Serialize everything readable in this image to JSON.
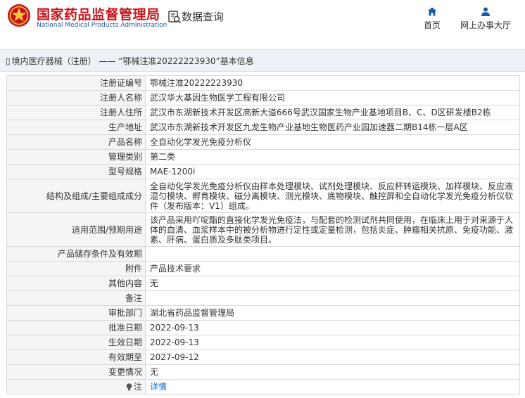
{
  "header": {
    "logo_cn": "国家药品监督管理局",
    "logo_en": "National Medical Products Administration",
    "query_label": "数据查询",
    "nav": [
      {
        "label": "首页",
        "icon": "home-icon"
      },
      {
        "label": "网上办事大厅",
        "icon": "user-icon"
      }
    ],
    "brand_color": "#c8161d",
    "accent_color": "#1a5aa6"
  },
  "breadcrumb": {
    "category": "境内医疗器械（注册）",
    "separator": "——",
    "title": "“鄂械注准20222223930”基本信息"
  },
  "details": {
    "reg_no": {
      "label": "注册证编号",
      "value": "鄂械注准20222223930"
    },
    "registrant": {
      "label": "注册人名称",
      "value": "武汉华大基因生物医学工程有限公司"
    },
    "registrant_address": {
      "label": "注册人住所",
      "value": "武汉市东湖新技术开发区高新大道666号武汉国家生物产业基地项目B、C、D区研发楼B2栋"
    },
    "production_address": {
      "label": "生产地址",
      "value": "武汉市东湖新技术开发区九龙生物产业基地生物医药产业园加速器二期B14栋一层A区"
    },
    "product_name": {
      "label": "产品名称",
      "value": "全自动化学发光免疫分析仪"
    },
    "management_class": {
      "label": "管理类别",
      "value": "第二类"
    },
    "model_spec": {
      "label": "型号规格",
      "value": "MAE-1200i"
    },
    "structure": {
      "label": "结构及组成/主要组成成分",
      "value": "全自动化学发光免疫分析仪由样本处理模块、试剂处理模块、反应杯转运模块、加样模块、反应液混匀模块、孵育模块、磁分离模块、测光模块、底物模块、触控屏和全自动化学发光免疫分析仪软件（发布版本：V1）组成。"
    },
    "scope": {
      "label": "适用范围/预期用途",
      "value": "该产品采用吖啶酯的直接化学发光免疫法，与配套的检测试剂共同使用，在临床上用于对来源于人体的血清、血浆样本中的被分析物进行定性或定量检测，包括炎症、肿瘤相关抗原、免疫功能、激素、肝病、蛋白质及多肽类项目。"
    },
    "storage": {
      "label": "产品储存条件及有效期",
      "value": ""
    },
    "attachment": {
      "label": "附件",
      "value": "产品技术要求"
    },
    "other": {
      "label": "其他内容",
      "value": "无"
    },
    "remark": {
      "label": "备注",
      "value": ""
    },
    "approval_dept": {
      "label": "审批部门",
      "value": "湖北省药品监督管理局"
    },
    "approval_date": {
      "label": "批准日期",
      "value": "2022-09-13"
    },
    "effective_date": {
      "label": "生效日期",
      "value": "2022-09-13"
    },
    "valid_until": {
      "label": "有效期至",
      "value": "2027-09-12"
    },
    "change": {
      "label": "变更情况",
      "value": "无"
    },
    "note": {
      "label": "注",
      "value": "详情"
    }
  }
}
